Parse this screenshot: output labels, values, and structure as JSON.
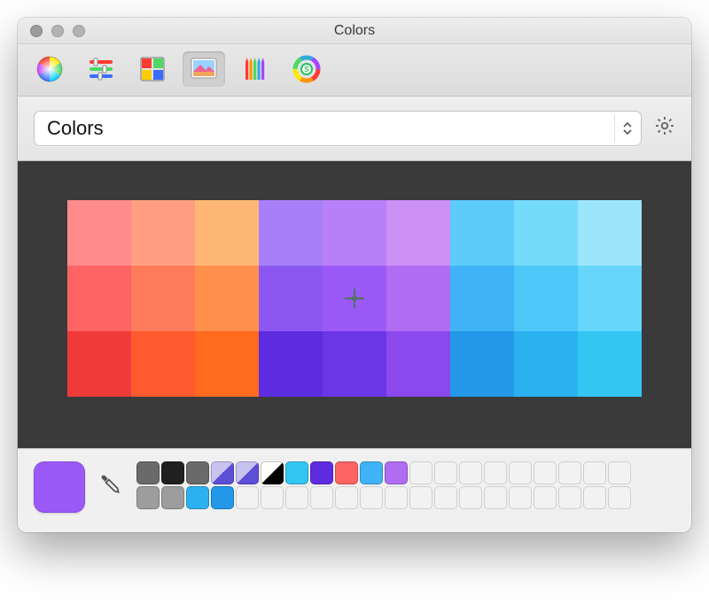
{
  "window": {
    "title": "Colors"
  },
  "toolbar": {
    "items": [
      {
        "name": "color-wheel",
        "selected": false
      },
      {
        "name": "color-sliders",
        "selected": false
      },
      {
        "name": "color-palettes",
        "selected": false
      },
      {
        "name": "image-palettes",
        "selected": true
      },
      {
        "name": "pencils",
        "selected": false
      },
      {
        "name": "spectrum",
        "selected": false
      }
    ]
  },
  "combo": {
    "label": "Colors"
  },
  "current_color": "#9B59F8",
  "palette_grid": [
    [
      "#FE8B8B",
      "#FF9E82",
      "#FFB775",
      "#A780F9",
      "#B780F9",
      "#CC8FF6",
      "#5DCBFA",
      "#74DBFC",
      "#9CE6FC"
    ],
    [
      "#FE6464",
      "#FF7B5B",
      "#FF904C",
      "#8C57F0",
      "#9B59F8",
      "#B06CF3",
      "#3FB3F5",
      "#4CC7F8",
      "#66D6FA"
    ],
    [
      "#F03A3A",
      "#FF5A2F",
      "#FF6A1F",
      "#5D2CE0",
      "#6C36E6",
      "#8B48EC",
      "#2398E8",
      "#2BB1F0",
      "#34C6F3"
    ]
  ],
  "saved_swatches": [
    {
      "fill": "#6a6a6a"
    },
    {
      "fill": "#202020"
    },
    {
      "fill": "#6a6a6a"
    },
    {
      "split": [
        "#c7c2f0",
        "#5d4ed6"
      ]
    },
    {
      "split": [
        "#c7c2f0",
        "#5d4ed6"
      ]
    },
    {
      "split": [
        "#ffffff",
        "#000000"
      ]
    },
    {
      "fill": "#34c6f3"
    },
    {
      "fill": "#5d2ce0"
    },
    {
      "fill": "#fe6464"
    },
    {
      "fill": "#3fb3f5"
    },
    {
      "fill": "#b06cf3"
    },
    null,
    null,
    null,
    null,
    null,
    null,
    null,
    null,
    null,
    {
      "fill": "#9d9d9d"
    },
    {
      "fill": "#9d9d9d"
    },
    {
      "fill": "#2bb1f0"
    },
    {
      "fill": "#2398e8"
    },
    null,
    null,
    null,
    null,
    null,
    null,
    null,
    null,
    null,
    null,
    null,
    null,
    null,
    null,
    null,
    null
  ]
}
